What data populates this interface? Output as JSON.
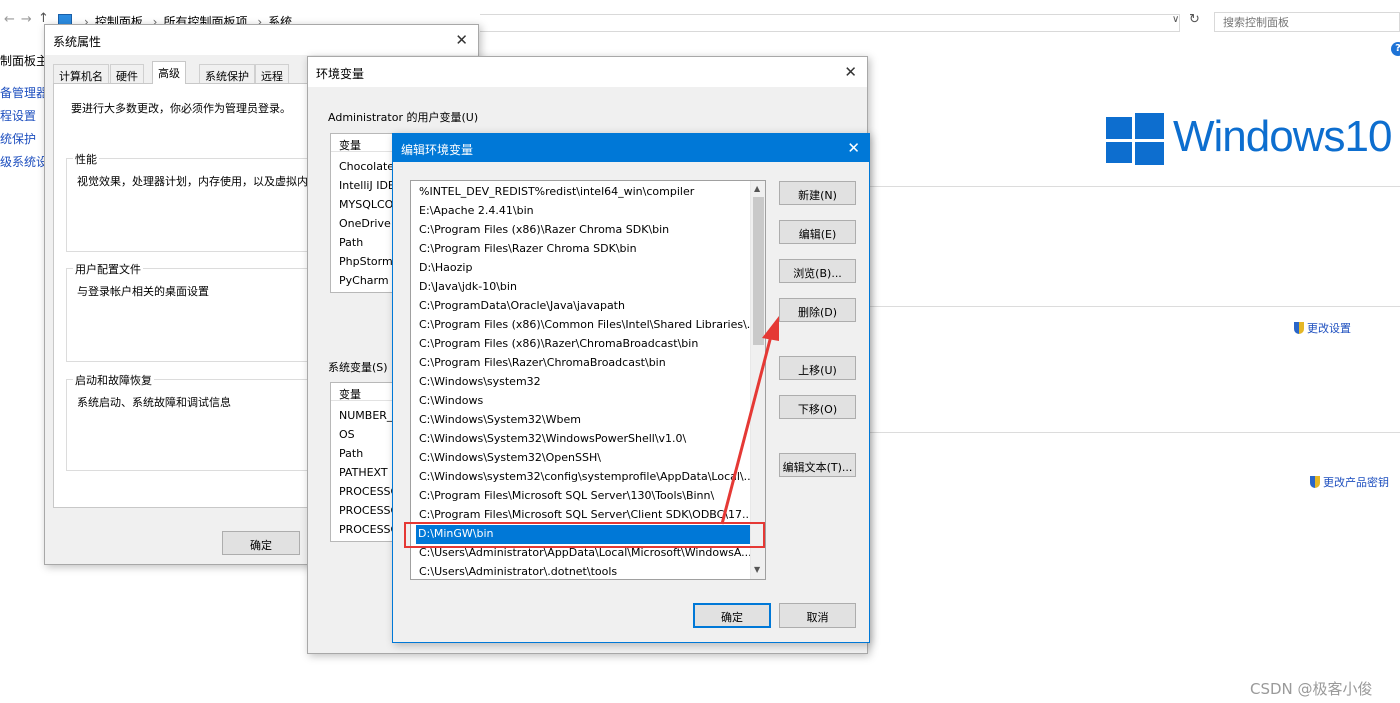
{
  "explorer": {
    "breadcrumbs": [
      "控制面板",
      "所有控制面板项",
      "系统"
    ],
    "search_placeholder": "搜索控制面板",
    "help_label": "?",
    "sidebar": [
      "制面板主页",
      "备管理器",
      "程设置",
      "统保护",
      "级系统设置"
    ],
    "links": {
      "change_settings": "更改设置",
      "change_product_key": "更改产品密钥"
    },
    "logo_text": "Windows10"
  },
  "system_properties": {
    "title": "系统属性",
    "tabs": [
      "计算机名",
      "硬件",
      "高级",
      "系统保护",
      "远程"
    ],
    "active_tab": 2,
    "admin_notice": "要进行大多数更改，你必须作为管理员登录。",
    "groups": [
      {
        "title": "性能",
        "text": "视觉效果，处理器计划，内存使用，以及虚拟内"
      },
      {
        "title": "用户配置文件",
        "text": "与登录帐户相关的桌面设置"
      },
      {
        "title": "启动和故障恢复",
        "text": "系统启动、系统故障和调试信息"
      }
    ],
    "ok_label": "确定"
  },
  "env_vars": {
    "title": "环境变量",
    "user_vars_label": "Administrator 的用户变量(U)",
    "column_variable": "变量",
    "user_vars": [
      "Chocolate",
      "IntelliJ IDE",
      "MYSQLCO",
      "OneDrive",
      "Path",
      "PhpStorm",
      "PyCharm"
    ],
    "system_vars_label": "系统变量(S)",
    "system_vars": [
      "NUMBER_",
      "OS",
      "Path",
      "PATHEXT",
      "PROCESSO",
      "PROCESSO",
      "PROCESSO"
    ]
  },
  "edit_env": {
    "title": "编辑环境变量",
    "paths": [
      "%INTEL_DEV_REDIST%redist\\intel64_win\\compiler",
      "E:\\Apache 2.4.41\\bin",
      "C:\\Program Files (x86)\\Razer Chroma SDK\\bin",
      "C:\\Program Files\\Razer Chroma SDK\\bin",
      "D:\\Haozip",
      "D:\\Java\\jdk-10\\bin",
      "C:\\ProgramData\\Oracle\\Java\\javapath",
      "C:\\Program Files (x86)\\Common Files\\Intel\\Shared Libraries\\...",
      "C:\\Program Files (x86)\\Razer\\ChromaBroadcast\\bin",
      "C:\\Program Files\\Razer\\ChromaBroadcast\\bin",
      "C:\\Windows\\system32",
      "C:\\Windows",
      "C:\\Windows\\System32\\Wbem",
      "C:\\Windows\\System32\\WindowsPowerShell\\v1.0\\",
      "C:\\Windows\\System32\\OpenSSH\\",
      "C:\\Windows\\system32\\config\\systemprofile\\AppData\\Local\\...",
      "C:\\Program Files\\Microsoft SQL Server\\130\\Tools\\Binn\\",
      "C:\\Program Files\\Microsoft SQL Server\\Client SDK\\ODBC\\17...",
      "D:\\MinGW\\bin",
      "C:\\Users\\Administrator\\AppData\\Local\\Microsoft\\WindowsA...",
      "C:\\Users\\Administrator\\.dotnet\\tools"
    ],
    "selected_index": 18,
    "buttons": {
      "new": "新建(N)",
      "edit": "编辑(E)",
      "browse": "浏览(B)...",
      "delete": "删除(D)",
      "move_up": "上移(U)",
      "move_down": "下移(O)",
      "edit_text": "编辑文本(T)...",
      "ok": "确定",
      "cancel": "取消"
    }
  },
  "watermark": "CSDN @极客小俊",
  "colors": {
    "accent": "#0078d7",
    "annotation": "#e53935",
    "windows_blue": "#0d6ecf"
  }
}
